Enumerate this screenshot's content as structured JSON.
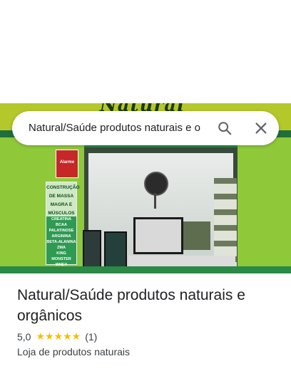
{
  "search": {
    "query": "Natural/Saúde produtos naturais e o"
  },
  "photo": {
    "awning_text": "Natural",
    "sign_alarm": "Alarme",
    "sign_heading": [
      "CONSTRUÇÃO",
      "DE MASSA",
      "MAGRA E",
      "MÚSCULOS"
    ],
    "sign_items": [
      "CREATINA",
      "BCAA",
      "PALATINOSE",
      "ARGININA",
      "BETA-ALANINA",
      "ZMA",
      "KING MONSTER",
      "WHEY"
    ]
  },
  "place": {
    "title": "Natural/Saúde produtos naturais e orgânicos",
    "rating": "5,0",
    "stars": "★★★★★",
    "review_count": "(1)",
    "category": "Loja de produtos naturais"
  },
  "colors": {
    "star": "#fbbc04",
    "text_primary": "#202124",
    "text_secondary": "#3c4043"
  }
}
